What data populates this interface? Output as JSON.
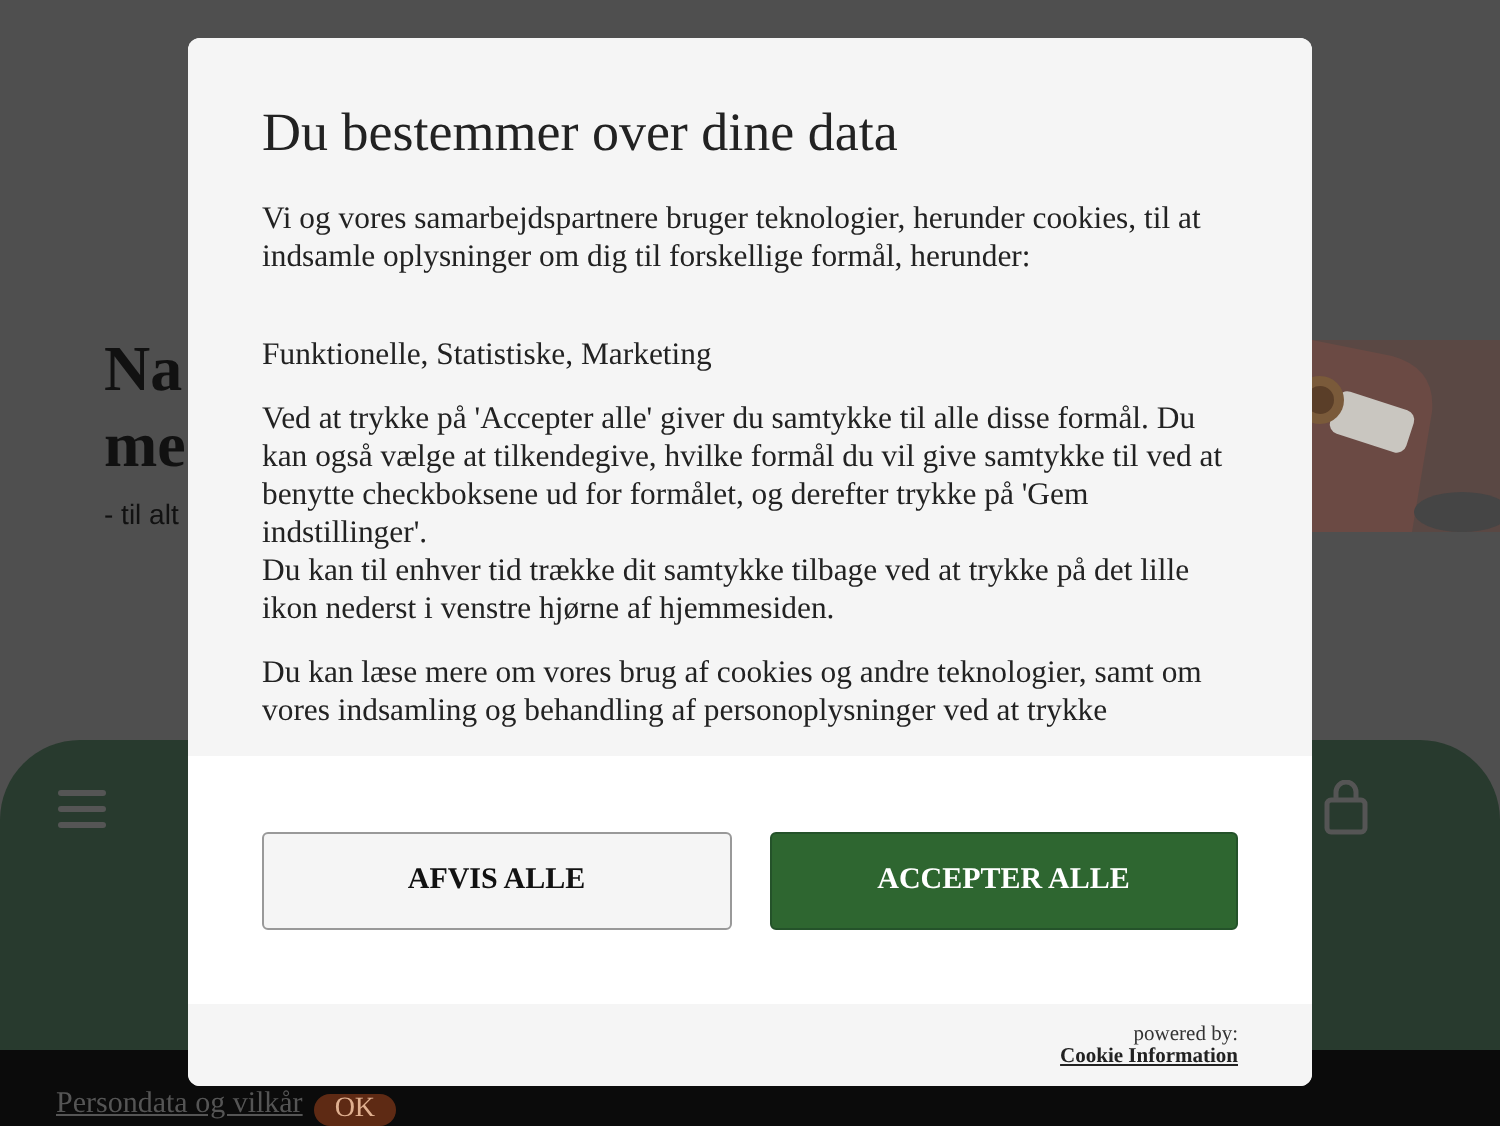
{
  "page": {
    "heading_lines": [
      "Na",
      "me"
    ],
    "tagline": "- til alt",
    "footer": {
      "link": "Persondata og vilkår",
      "button": "OK"
    }
  },
  "dialog": {
    "title": "Du bestemmer over dine data",
    "paragraphs": [
      [
        "Vi og vores samarbejdspartnere bruger teknologier, herunder cookies, til at indsamle oplysninger om dig til forskellige formål, herunder:"
      ],
      [
        "Funktionelle, Statistiske, Marketing"
      ],
      [
        "Ved at trykke på 'Accepter alle' giver du samtykke til alle disse formål. Du kan også vælge at tilkendegive, hvilke formål du vil give samtykke til ved at benytte checkboksene ud for formålet, og derefter trykke på 'Gem indstillinger'.",
        "Du kan til enhver tid trække dit samtykke tilbage ved at trykke på det lille ikon nederst i venstre hjørne af hjemmesiden."
      ],
      [
        "Du kan læse mere om vores brug af cookies og andre teknologier, samt om vores indsamling og behandling af personoplysninger ved at trykke"
      ]
    ],
    "buttons": [
      {
        "label": "AFVIS ALLE",
        "kind": "secondary"
      },
      {
        "label": "ACCEPTER ALLE",
        "kind": "primary"
      }
    ],
    "powered_by": "powered by:",
    "provider_link": "Cookie Information"
  }
}
